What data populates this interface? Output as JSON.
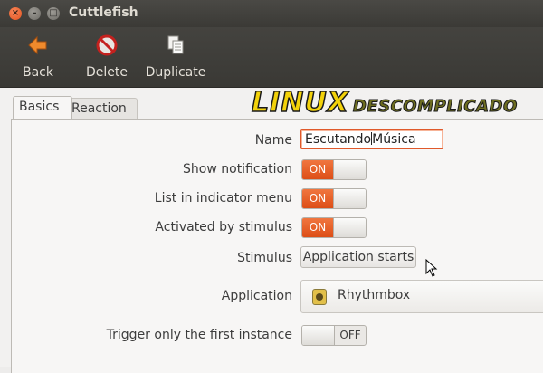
{
  "window": {
    "title": "Cuttlefish",
    "controls": {
      "close": "×",
      "minimize": "–",
      "maximize": "□"
    }
  },
  "toolbar": {
    "back_label": "Back",
    "delete_label": "Delete",
    "duplicate_label": "Duplicate",
    "icons": {
      "back": "arrow-left-icon",
      "delete": "delete-icon",
      "duplicate": "duplicate-icon"
    }
  },
  "watermark": {
    "part1": "LINUX",
    "part2": "DESCOMPLICADO"
  },
  "tabs": [
    {
      "label": "Basics",
      "active": true
    },
    {
      "label": "Reaction",
      "active": false
    }
  ],
  "form": {
    "name": {
      "label": "Name",
      "value_before": "Escutando",
      "value_after": "Música"
    },
    "show_notification": {
      "label": "Show notification",
      "state": "ON"
    },
    "list_in_indicator": {
      "label": "List in indicator menu",
      "state": "ON"
    },
    "activated_by_stimulus": {
      "label": "Activated by stimulus",
      "state": "ON"
    },
    "stimulus": {
      "label": "Stimulus",
      "value": "Application starts"
    },
    "application": {
      "label": "Application",
      "value": "Rhythmbox",
      "icon": "rhythmbox-icon"
    },
    "trigger_first_instance": {
      "label": "Trigger only the first instance",
      "state": "OFF"
    }
  },
  "colors": {
    "accent": "#e05a24",
    "titlebar": "#3c3b37"
  }
}
